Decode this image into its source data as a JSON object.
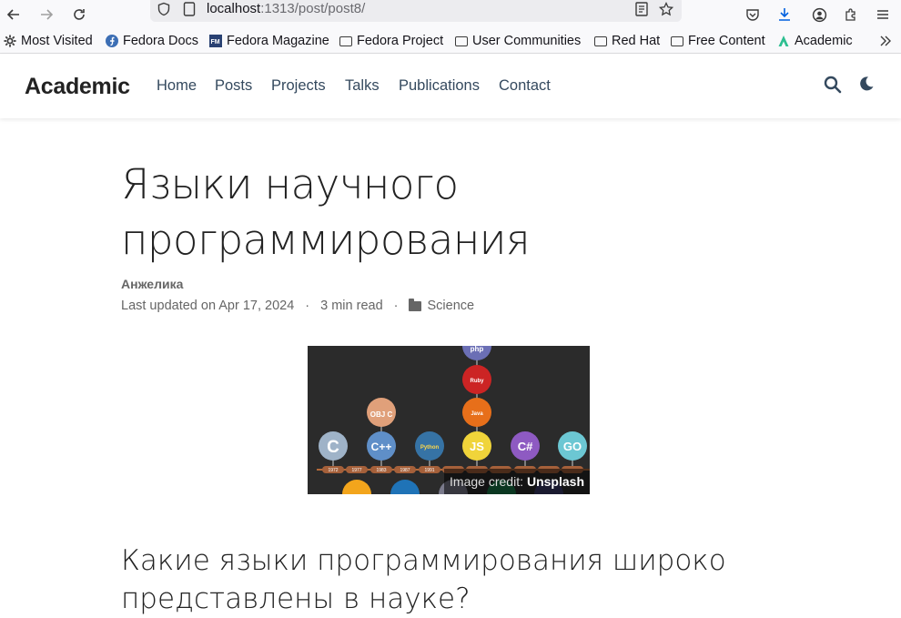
{
  "browser": {
    "url_host": "localhost",
    "url_rest": ":1313/post/post8/",
    "bookmarks": [
      {
        "label": "Most Visited",
        "icon": "gear-icon"
      },
      {
        "label": "Fedora Docs",
        "icon": "fedora-icon"
      },
      {
        "label": "Fedora Magazine",
        "icon": "fm-icon"
      },
      {
        "label": "Fedora Project",
        "icon": "folder-icon"
      },
      {
        "label": "User Communities",
        "icon": "folder-icon"
      },
      {
        "label": "Red Hat",
        "icon": "folder-icon"
      },
      {
        "label": "Free Content",
        "icon": "folder-icon"
      },
      {
        "label": "Academic",
        "icon": "academic-icon"
      }
    ]
  },
  "site": {
    "brand": "Academic",
    "nav": [
      "Home",
      "Posts",
      "Projects",
      "Talks",
      "Publications",
      "Contact"
    ]
  },
  "article": {
    "title_line1": "Языки научного",
    "title_line2": "программирования",
    "author": "Анжелика",
    "updated": "Last updated on Apr 17, 2024",
    "sep": "·",
    "read_time": "3 min read",
    "category": "Science",
    "image_credit_prefix": "Image credit:",
    "image_credit_source": "Unsplash",
    "heading_line1": "Какие языки программирования широко",
    "heading_line2": "представлены в науке?"
  },
  "hero_image": {
    "years": [
      "1972",
      "1977",
      "1983",
      "1987",
      "1991"
    ],
    "badges": [
      "C",
      "C++",
      "OBJ C",
      "Python",
      "JS",
      "C#",
      "GO",
      "php",
      "Ruby",
      "Java"
    ]
  },
  "colors": {
    "accent": "#34495e",
    "toolbar_bg": "#f9f9fb",
    "url_bg": "#ececef"
  }
}
